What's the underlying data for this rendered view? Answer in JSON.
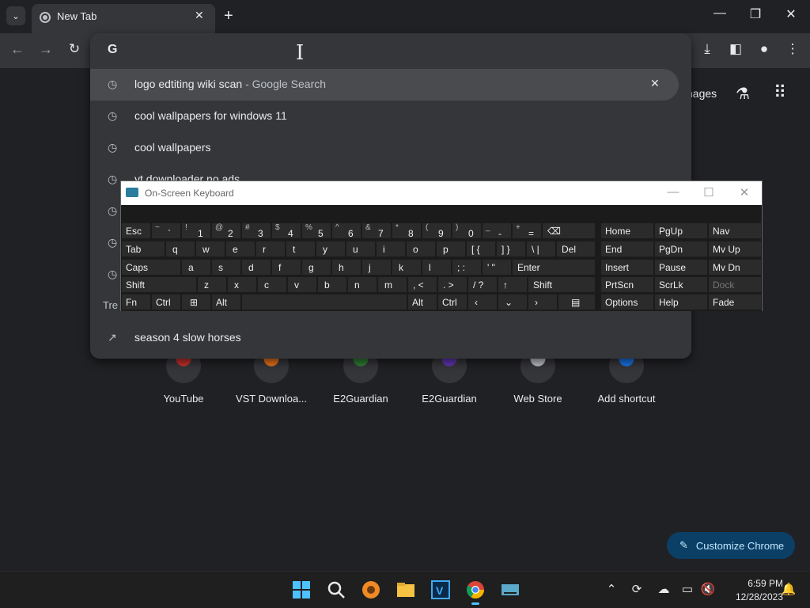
{
  "browser": {
    "tab_title": "New Tab",
    "toolbar_icons": [
      "back-icon",
      "forward-icon",
      "reload-icon",
      "download-icon",
      "side-panel-icon",
      "profile-icon",
      "menu-icon"
    ]
  },
  "omnibox": {
    "logo": "G",
    "suggestions": [
      {
        "text": "logo edtiting wiki scan",
        "suffix": " - Google Search",
        "icon": "history-icon"
      },
      {
        "text": "cool wallpapers for windows 11",
        "suffix": "",
        "icon": "history-icon"
      },
      {
        "text": "cool wallpapers",
        "suffix": "",
        "icon": "history-icon"
      },
      {
        "text": "yt downloader no ads",
        "suffix": "",
        "icon": "history-icon"
      }
    ],
    "trending_header": "Tre",
    "trending": [
      {
        "text": "season 4 slow horses",
        "icon": "trending-icon"
      }
    ]
  },
  "page": {
    "images_link": "nages",
    "shortcuts": [
      {
        "label": "YouTube",
        "color": "#c4302b"
      },
      {
        "label": "VST Downloa...",
        "color": "#e8711a"
      },
      {
        "label": "E2Guardian",
        "color": "#2e7d32"
      },
      {
        "label": "E2Guardian",
        "color": "#5e35b1"
      },
      {
        "label": "Web Store",
        "color": "#bdc1c6"
      },
      {
        "label": "Add shortcut",
        "color": "#1a73e8"
      }
    ],
    "customize_label": "Customize Chrome"
  },
  "osk": {
    "title": "On-Screen Keyboard",
    "rows": {
      "row1": [
        {
          "main": "Esc"
        },
        {
          "shift": "~",
          "base": "`"
        },
        {
          "shift": "!",
          "base": "1"
        },
        {
          "shift": "@",
          "base": "2"
        },
        {
          "shift": "#",
          "base": "3"
        },
        {
          "shift": "$",
          "base": "4"
        },
        {
          "shift": "%",
          "base": "5"
        },
        {
          "shift": "^",
          "base": "6"
        },
        {
          "shift": "&",
          "base": "7"
        },
        {
          "shift": "*",
          "base": "8"
        },
        {
          "shift": "(",
          "base": "9"
        },
        {
          "shift": ")",
          "base": "0"
        },
        {
          "shift": "_",
          "base": "-"
        },
        {
          "shift": "+",
          "base": "="
        },
        {
          "main": "⌫"
        }
      ],
      "row2": [
        "Tab",
        "q",
        "w",
        "e",
        "r",
        "t",
        "y",
        "u",
        "i",
        "o",
        "p",
        "[ {",
        "] }",
        "\\ |",
        "Del"
      ],
      "row3": [
        "Caps",
        "a",
        "s",
        "d",
        "f",
        "g",
        "h",
        "j",
        "k",
        "l",
        "; :",
        "' \"",
        "Enter"
      ],
      "row4": [
        "Shift",
        "z",
        "x",
        "c",
        "v",
        "b",
        "n",
        "m",
        ", <",
        ". >",
        "/ ?",
        "↑",
        "Shift"
      ],
      "row5": [
        "Fn",
        "Ctrl",
        "⊞",
        "Alt",
        "",
        "Alt",
        "Ctrl",
        "‹",
        "⌄",
        "›",
        "▤"
      ]
    },
    "side": [
      [
        "Home",
        "PgUp",
        "Nav"
      ],
      [
        "End",
        "PgDn",
        "Mv Up"
      ],
      [
        "Insert",
        "Pause",
        "Mv Dn"
      ],
      [
        "PrtScn",
        "ScrLk",
        "Dock"
      ],
      [
        "Options",
        "Help",
        "Fade"
      ]
    ]
  },
  "taskbar": {
    "time": "6:59 PM",
    "date": "12/28/2023"
  }
}
